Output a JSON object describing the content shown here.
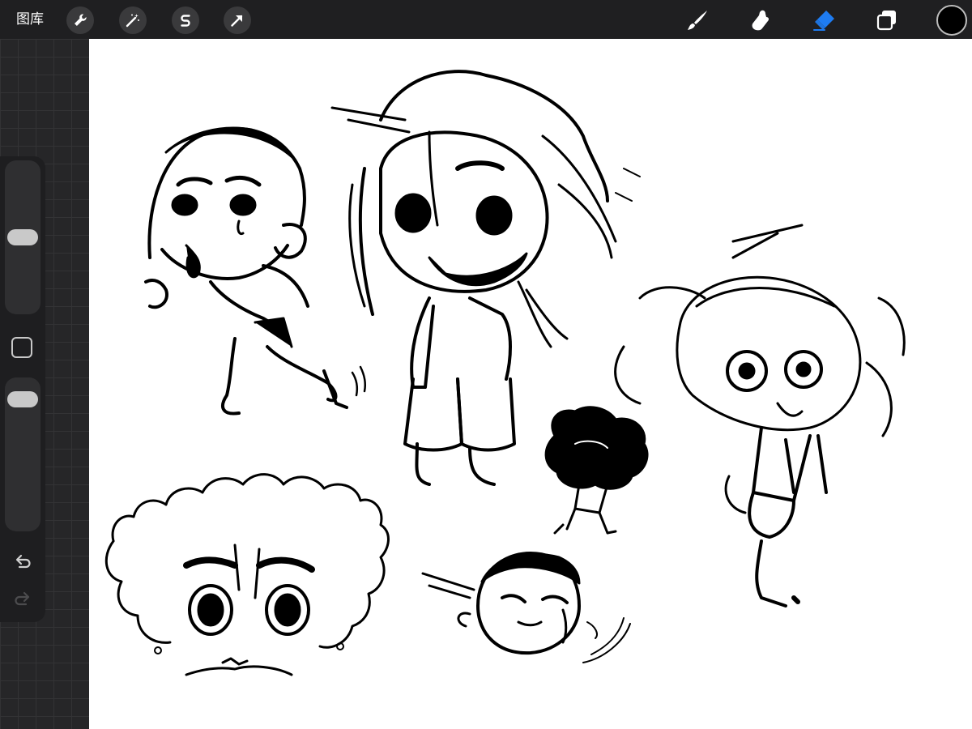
{
  "toolbar": {
    "gallery_label": "图库",
    "left_tools": [
      "wrench-icon",
      "magic-wand-icon",
      "selection-s-icon",
      "transform-arrow-icon"
    ],
    "right_tools": [
      "brush-icon",
      "smudge-icon",
      "eraser-icon",
      "layers-icon"
    ],
    "active_tool": "eraser",
    "active_tool_color": "#1e7cf2",
    "current_color": "#000000"
  },
  "sidebar": {
    "brush_size_level": 0.5,
    "opacity_level": 0.93,
    "modify_button": "square-icon",
    "undo": "undo-arrow-icon",
    "redo": "redo-arrow-icon"
  },
  "canvas": {
    "background": "#ffffff",
    "ink_color": "#000000",
    "sketches": [
      "chibi-running-boy",
      "chibi-long-hair-bearded-man",
      "small-curly-hair-figure",
      "chibi-girl-wide-eyes",
      "curly-hair-face",
      "crying-head"
    ]
  }
}
